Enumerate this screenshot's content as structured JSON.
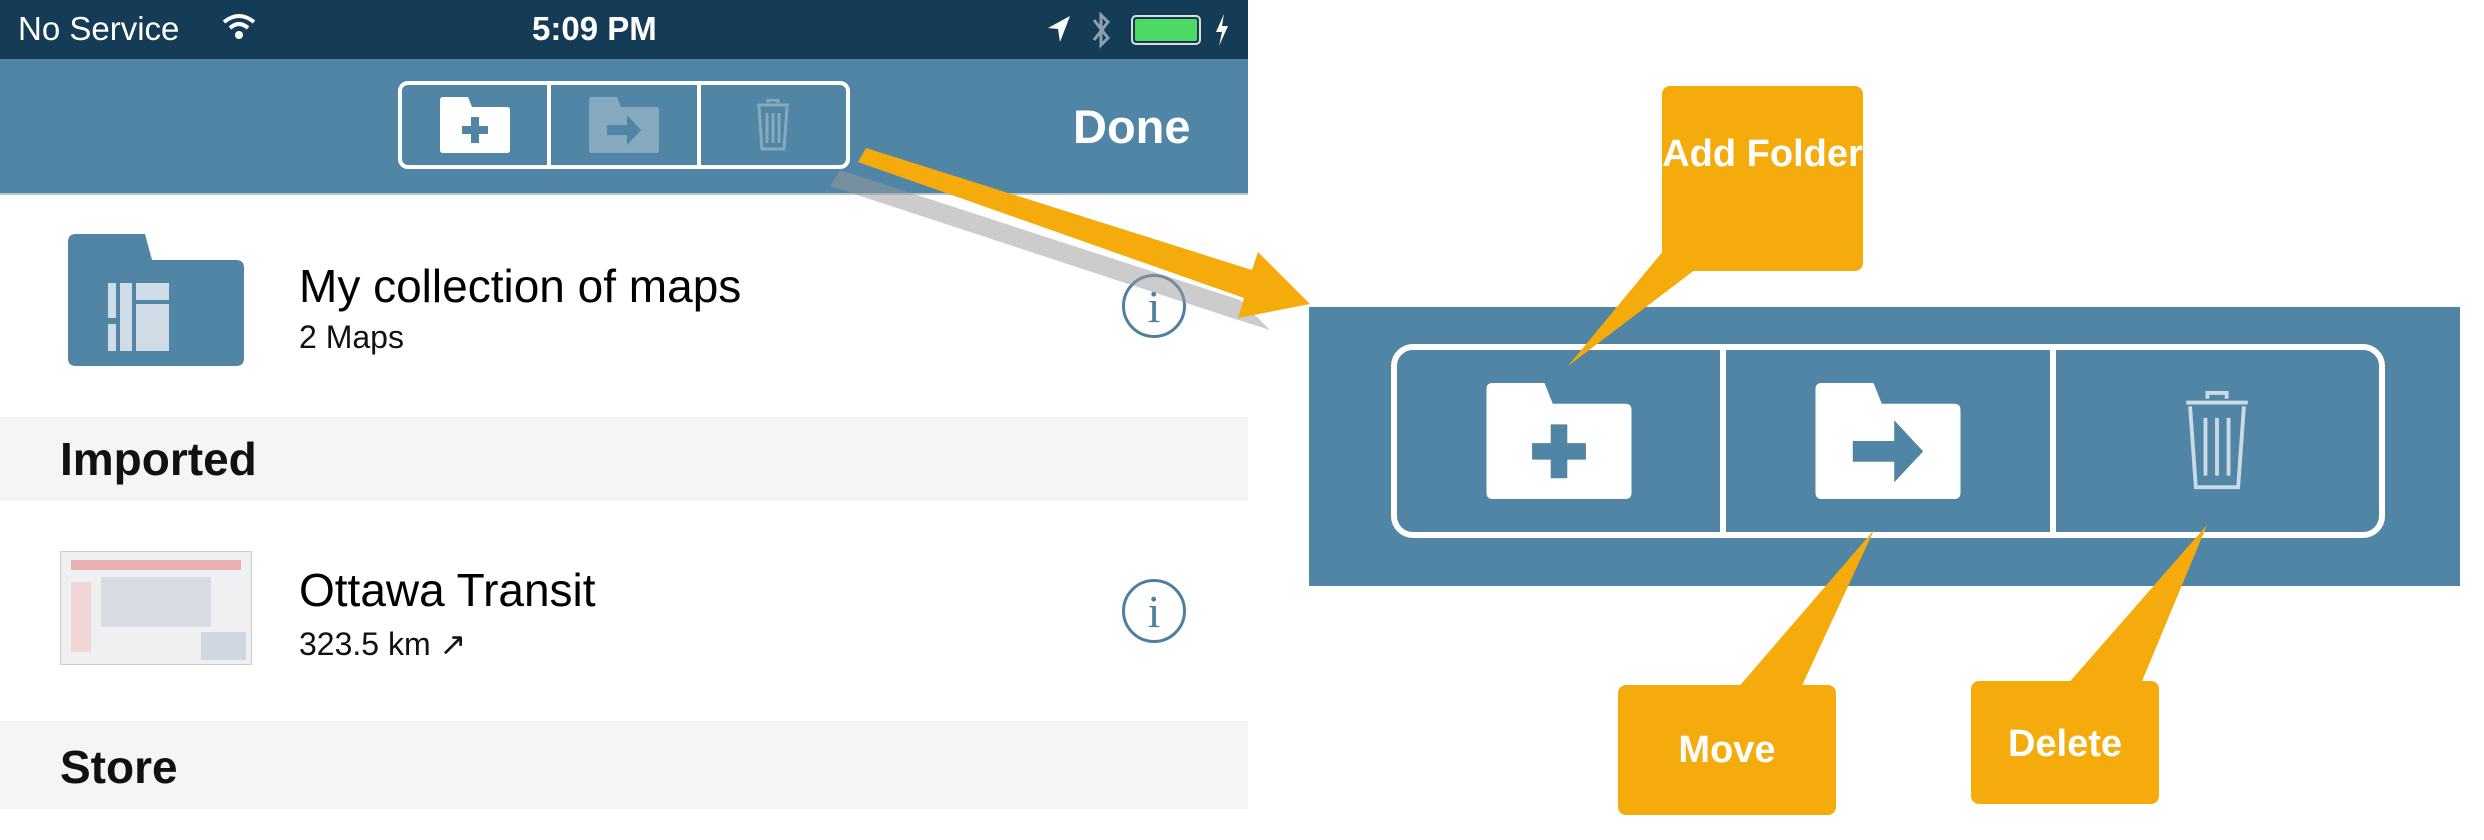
{
  "status_bar": {
    "carrier": "No Service",
    "time": "5:09 PM",
    "battery_color": "#4cd964"
  },
  "nav_bar": {
    "done_label": "Done",
    "actions": [
      {
        "name": "add-folder",
        "icon": "folder-plus-icon",
        "enabled": true
      },
      {
        "name": "move",
        "icon": "folder-arrow-icon",
        "enabled": false
      },
      {
        "name": "delete",
        "icon": "trash-icon",
        "enabled": false
      }
    ]
  },
  "list": {
    "collection": {
      "title": "My collection of maps",
      "subtitle": "2 Maps"
    },
    "sections": [
      {
        "title": "Imported",
        "items": [
          {
            "title": "Ottawa Transit",
            "subtitle": "323.5 km ↗"
          }
        ]
      },
      {
        "title": "Store"
      }
    ]
  },
  "callouts": {
    "add_folder": "Add Folder",
    "move": "Move",
    "delete": "Delete"
  },
  "colors": {
    "nav_blue": "#5085a5",
    "status_dark": "#153c57",
    "callout_orange": "#f5ab0b"
  }
}
